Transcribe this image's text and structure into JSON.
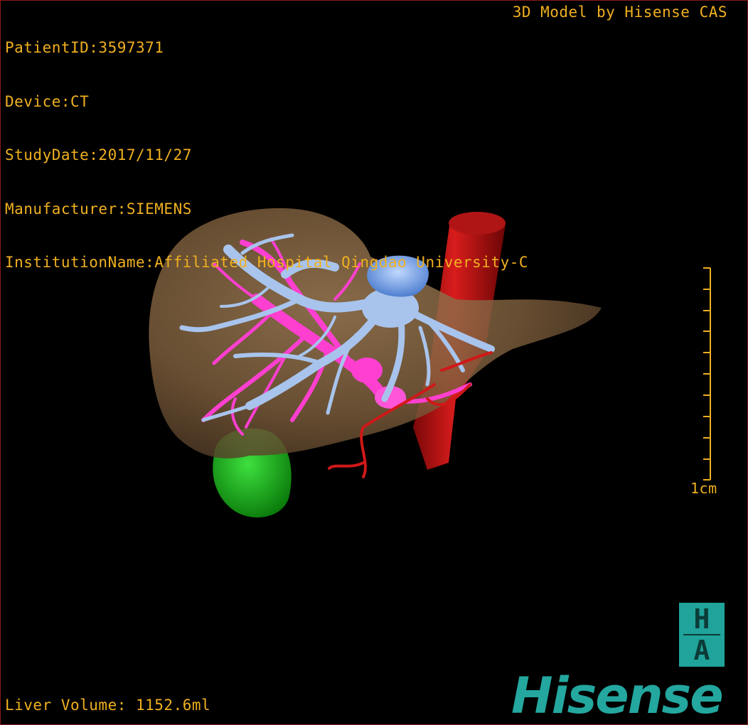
{
  "info": {
    "patient_id": "PatientID:3597371",
    "device": "Device:CT",
    "study_date": "StudyDate:2017/11/27",
    "manufacturer": "Manufacturer:SIEMENS",
    "institution": "InstitutionName:Affiliated Hospital Qingdao University-C"
  },
  "credit": "3D Model by Hisense CAS",
  "liver_volume": "Liver Volume: 1152.6ml",
  "scale_label": "1cm",
  "logo": {
    "top_letter": "H",
    "bottom_letter": "A",
    "brand": "Hisense",
    "brand_color": "#23a79f"
  },
  "colors": {
    "overlay_text": "#f0b020",
    "liver": "#8a6a44",
    "hepatic_vein": "#a8c4ec",
    "portal_vein": "#ff3fd0",
    "artery": "#cc1010",
    "gallbladder": "#18b818",
    "ivc_top": "#6e9ee8"
  }
}
